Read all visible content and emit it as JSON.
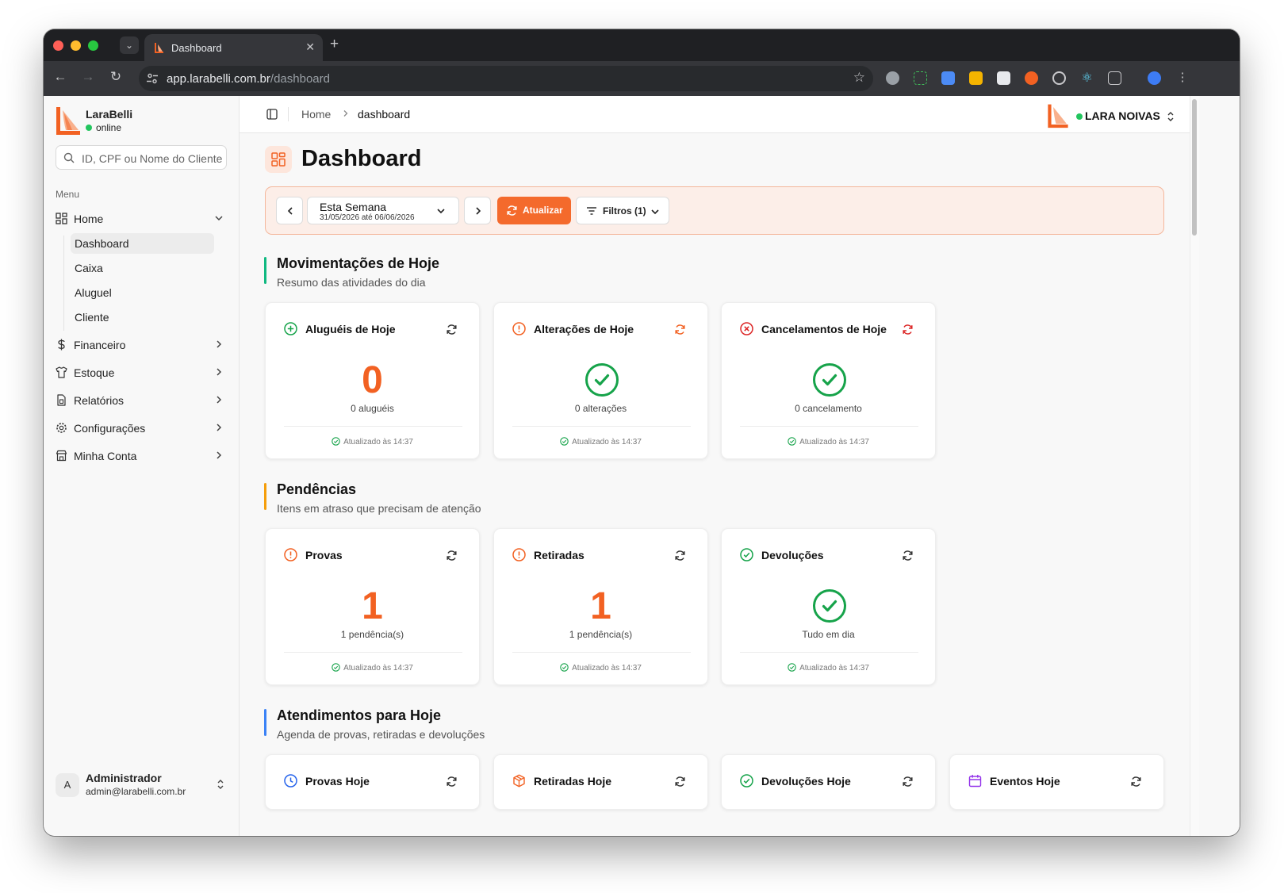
{
  "browser": {
    "tab_title": "Dashboard",
    "url_host": "app.larabelli.com.br",
    "url_path": "/dashboard"
  },
  "sidebar": {
    "brand": "LaraBelli",
    "status": "online",
    "search_placeholder": "ID, CPF ou Nome do Cliente",
    "menu_label": "Menu",
    "items": [
      {
        "label": "Home",
        "icon": "layout-grid-icon",
        "expanded": true
      },
      {
        "label": "Financeiro",
        "icon": "dollar-icon"
      },
      {
        "label": "Estoque",
        "icon": "shirt-icon"
      },
      {
        "label": "Relatórios",
        "icon": "file-chart-icon"
      },
      {
        "label": "Configurações",
        "icon": "gear-icon"
      },
      {
        "label": "Minha Conta",
        "icon": "store-icon"
      }
    ],
    "home_subitems": [
      "Dashboard",
      "Caixa",
      "Aluguel",
      "Cliente"
    ],
    "active_subitem": "Dashboard",
    "user": {
      "initial": "A",
      "name": "Administrador",
      "email": "admin@larabelli.com.br"
    }
  },
  "topbar": {
    "breadcrumb_home": "Home",
    "breadcrumb_current": "dashboard",
    "store_name": "LARA NOIVAS"
  },
  "page_title": "Dashboard",
  "filters": {
    "period_label": "Esta Semana",
    "period_range": "31/05/2026 até 06/06/2026",
    "refresh_label": "Atualizar",
    "filters_label": "Filtros (1)"
  },
  "colors": {
    "accent": "#f46a2c",
    "success": "#16a34a",
    "section_today": "#10b981",
    "section_pending": "#f59e0b",
    "section_appointments": "#3b82f6"
  },
  "sections": {
    "today": {
      "title": "Movimentações de Hoje",
      "subtitle": "Resumo das atividades do dia",
      "cards": [
        {
          "title": "Aluguéis de Hoje",
          "value": "0",
          "sub": "0 aluguéis",
          "updated": "Atualizado às 14:37"
        },
        {
          "title": "Alterações de Hoje",
          "sub": "0 alterações",
          "updated": "Atualizado às 14:37"
        },
        {
          "title": "Cancelamentos de Hoje",
          "sub": "0 cancelamento",
          "updated": "Atualizado às 14:37"
        }
      ]
    },
    "pending": {
      "title": "Pendências",
      "subtitle": "Itens em atraso que precisam de atenção",
      "cards": [
        {
          "title": "Provas",
          "value": "1",
          "sub": "1 pendência(s)",
          "updated": "Atualizado às 14:37"
        },
        {
          "title": "Retiradas",
          "value": "1",
          "sub": "1 pendência(s)",
          "updated": "Atualizado às 14:37"
        },
        {
          "title": "Devoluções",
          "sub": "Tudo em dia",
          "updated": "Atualizado às 14:37"
        }
      ]
    },
    "appointments": {
      "title": "Atendimentos para Hoje",
      "subtitle": "Agenda de provas, retiradas e devoluções",
      "cards": [
        {
          "title": "Provas Hoje"
        },
        {
          "title": "Retiradas Hoje"
        },
        {
          "title": "Devoluções Hoje"
        },
        {
          "title": "Eventos Hoje"
        }
      ]
    }
  }
}
